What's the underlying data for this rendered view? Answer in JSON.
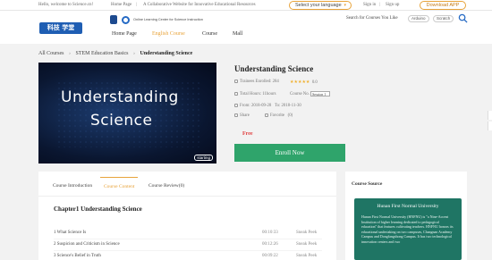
{
  "topbar": {
    "welcome": "Hello, welcome to Science.cn!",
    "home": "Home Page",
    "separator": "|",
    "collab": "A Collaborative Website for Innovative Educational Resources",
    "language": "Select your language",
    "language_arrow": "▾",
    "signin": "Sign in",
    "pipe": "|",
    "signup": "Sign up",
    "download": "Download APP"
  },
  "header": {
    "logo_text": "科技 学堂",
    "logo_sub": "",
    "partner_text": "Online Learning Center for Science Instruction",
    "nav": [
      "Home Page",
      "English Course",
      "Course",
      "Mall"
    ],
    "search_label": "Search for Courses You Like",
    "tags": [
      "Arduino",
      "Scratch"
    ]
  },
  "breadcrumb": {
    "items": [
      "All Courses",
      "STEM Education Basics",
      "Understanding Science"
    ],
    "chevron": "›"
  },
  "hero": {
    "line1": "Understanding",
    "line2": "Science",
    "badge": "starting"
  },
  "course": {
    "title": "Understanding Science",
    "trainees_label": "Trainees Enrolled:",
    "trainees_value": "284",
    "rating_stars": "★★★★★",
    "rating_value": "0.0",
    "total_hours_label": "Total Hours:",
    "total_hours_value": "11hours",
    "course_no_label": "Course No.",
    "version": "Session 1",
    "from_label": "From:",
    "from_value": "2018-09-28",
    "to_label": "To:",
    "to_value": "2018-11-30",
    "share": "Share",
    "favorite_label": "Favorite",
    "favorite_count": "(0)",
    "price": "Free",
    "enroll": "Enroll Now"
  },
  "tabs": [
    "Course Introduction",
    "Course Content",
    "Course Review(0)"
  ],
  "content": {
    "chapter": "Chapter1 Understanding Science",
    "lessons": [
      {
        "title": "1 What Science Is",
        "duration": "00:10:33",
        "action": "Sneak Peek"
      },
      {
        "title": "2 Suspicion and Criticism in Science",
        "duration": "00:12:26",
        "action": "Sneak Peek"
      },
      {
        "title": "3 Science's Belief in Truth",
        "duration": "00:09:22",
        "action": "Sneak Peek"
      }
    ]
  },
  "side": {
    "title": "Course Source",
    "school": "Hunan First Normal University",
    "description": "Hunan First Normal University (HNFNU) is \"a Nine-Accent Institution of higher learning dedicated to pedagogical education\" that features cultivating teachers. HNFNU honors its educational undertaking on two campuses, Changnan Academy Campus and Dongfangshong Campus. It has two technological innovation centers and two"
  },
  "colors": {
    "accent": "#e8a33a",
    "enroll": "#2fa46b",
    "price": "#e03c3c",
    "school_card": "#1f7564"
  }
}
